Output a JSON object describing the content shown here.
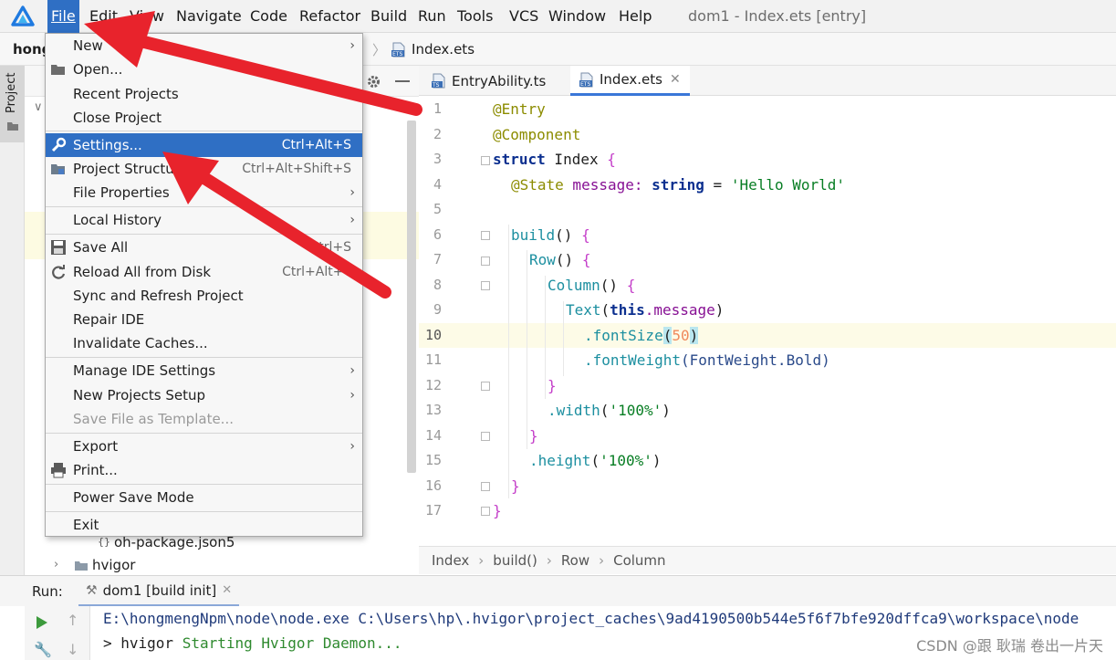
{
  "menubar": {
    "items": [
      "File",
      "Edit",
      "View",
      "Navigate",
      "Code",
      "Refactor",
      "Build",
      "Run",
      "Tools",
      "VCS",
      "Window",
      "Help"
    ],
    "title": "dom1 - Index.ets [entry]"
  },
  "navbar": {
    "project": "hong",
    "file": "Index.ets"
  },
  "sidebar": {
    "project_tab": "Project"
  },
  "project_tree": {
    "visible_rows": [
      {
        "label": "oh-package.json5"
      },
      {
        "label": "hvigor"
      }
    ]
  },
  "file_menu": {
    "items": [
      {
        "label": "New",
        "shortcut": "",
        "submenu": true
      },
      {
        "label": "Open...",
        "shortcut": "",
        "submenu": false
      },
      {
        "label": "Recent Projects",
        "shortcut": "",
        "submenu": false
      },
      {
        "label": "Close Project",
        "shortcut": "",
        "submenu": false
      },
      {
        "label": "Settings...",
        "shortcut": "Ctrl+Alt+S",
        "submenu": false
      },
      {
        "label": "Project Structure...",
        "shortcut": "Ctrl+Alt+Shift+S",
        "submenu": false
      },
      {
        "label": "File Properties",
        "shortcut": "",
        "submenu": true
      },
      {
        "label": "Local History",
        "shortcut": "",
        "submenu": true
      },
      {
        "label": "Save All",
        "shortcut": "Ctrl+S",
        "submenu": false
      },
      {
        "label": "Reload All from Disk",
        "shortcut": "Ctrl+Alt+Y",
        "submenu": false
      },
      {
        "label": "Sync and Refresh Project",
        "shortcut": "",
        "submenu": false
      },
      {
        "label": "Repair IDE",
        "shortcut": "",
        "submenu": false
      },
      {
        "label": "Invalidate Caches...",
        "shortcut": "",
        "submenu": false
      },
      {
        "label": "Manage IDE Settings",
        "shortcut": "",
        "submenu": true
      },
      {
        "label": "New Projects Setup",
        "shortcut": "",
        "submenu": true
      },
      {
        "label": "Save File as Template...",
        "shortcut": "",
        "submenu": false
      },
      {
        "label": "Export",
        "shortcut": "",
        "submenu": true
      },
      {
        "label": "Print...",
        "shortcut": "",
        "submenu": false
      },
      {
        "label": "Power Save Mode",
        "shortcut": "",
        "submenu": false
      },
      {
        "label": "Exit",
        "shortcut": "",
        "submenu": false
      }
    ]
  },
  "editor": {
    "tabs": [
      {
        "label": "EntryAbility.ts",
        "badge": "TS"
      },
      {
        "label": "Index.ets",
        "badge": "ETS"
      }
    ],
    "line_numbers": [
      "1",
      "2",
      "3",
      "4",
      "5",
      "6",
      "7",
      "8",
      "9",
      "10",
      "11",
      "12",
      "13",
      "14",
      "15",
      "16",
      "17"
    ],
    "code": {
      "l1": "@Entry",
      "l2": "@Component",
      "l3_kw": "struct",
      "l3_name": " Index ",
      "l3_brace": "{",
      "l4_ann": "@State",
      "l4_rest": " message: ",
      "l4_type": "string",
      "l4_eq": " = ",
      "l4_str": "'Hello World'",
      "l6_fn": "build",
      "l6_paren": "() ",
      "l6_brace": "{",
      "l7_fn": "Row",
      "l7_paren": "() ",
      "l7_brace": "{",
      "l8_fn": "Column",
      "l8_paren": "() ",
      "l8_brace": "{",
      "l9_fn": "Text",
      "l9_open": "(",
      "l9_kw": "this",
      "l9_prop": ".message",
      "l9_close": ")",
      "l10_fn": ".fontSize",
      "l10_open": "(",
      "l10_num": "50",
      "l10_close": ")",
      "l11_fn": ".fontWeight",
      "l11_arg": "(FontWeight.Bold)",
      "l12": "}",
      "l13_fn": ".width",
      "l13_open": "(",
      "l13_str": "'100%'",
      "l13_close": ")",
      "l14": "}",
      "l15_fn": ".height",
      "l15_open": "(",
      "l15_str": "'100%'",
      "l15_close": ")",
      "l16": "}",
      "l17": "}"
    },
    "breadcrumbs": [
      "Index",
      "build()",
      "Row",
      "Column"
    ]
  },
  "run_panel": {
    "label": "Run:",
    "tab": "dom1 [build init]",
    "console": [
      "E:\\hongmengNpm\\node\\node.exe C:\\Users\\hp\\.hvigor\\project_caches\\9ad4190500b544e5f6f7bfe920dffca9\\workspace\\node",
      "> hvigor ",
      "Starting Hvigor Daemon..."
    ]
  },
  "watermark": "CSDN @跟 耿瑞 卷出一片天",
  "colors": {
    "selection": "#2f6fc4",
    "arrow": "#e8232c",
    "current_line": "#fdfbe7"
  }
}
